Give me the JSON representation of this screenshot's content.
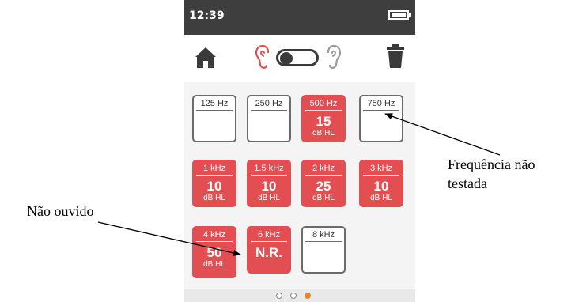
{
  "status": {
    "time": "12:39"
  },
  "toolbar": {
    "home": "home-icon",
    "trash": "trash-icon",
    "left_ear": "ear-icon",
    "right_ear": "ear-icon"
  },
  "colors": {
    "accent": "#e24e52",
    "active_dot": "#e8872f",
    "statusbar": "#3e3e3e"
  },
  "tiles": [
    {
      "freq": "125 Hz",
      "value": "",
      "unit": "",
      "state": "empty"
    },
    {
      "freq": "250 Hz",
      "value": "",
      "unit": "",
      "state": "empty"
    },
    {
      "freq": "500 Hz",
      "value": "15",
      "unit": "dB HL",
      "state": "filled"
    },
    {
      "freq": "750 Hz",
      "value": "",
      "unit": "",
      "state": "empty"
    },
    {
      "freq": "1 kHz",
      "value": "10",
      "unit": "dB HL",
      "state": "filled"
    },
    {
      "freq": "1.5 kHz",
      "value": "10",
      "unit": "dB HL",
      "state": "filled"
    },
    {
      "freq": "2 kHz",
      "value": "25",
      "unit": "dB HL",
      "state": "filled"
    },
    {
      "freq": "3 kHz",
      "value": "10",
      "unit": "dB HL",
      "state": "filled"
    },
    {
      "freq": "4 kHz",
      "value": "50",
      "unit": "dB HL",
      "state": "filled"
    },
    {
      "freq": "6 kHz",
      "value": "N.R.",
      "unit": "",
      "state": "filled"
    },
    {
      "freq": "8 kHz",
      "value": "",
      "unit": "",
      "state": "empty"
    }
  ],
  "pager": {
    "pages": 3,
    "active": 3
  },
  "annotations": {
    "not_tested": "Frequência não testada",
    "not_tested_line1": "Frequência não",
    "not_tested_line2": "testada",
    "not_heard": "Não ouvido"
  }
}
